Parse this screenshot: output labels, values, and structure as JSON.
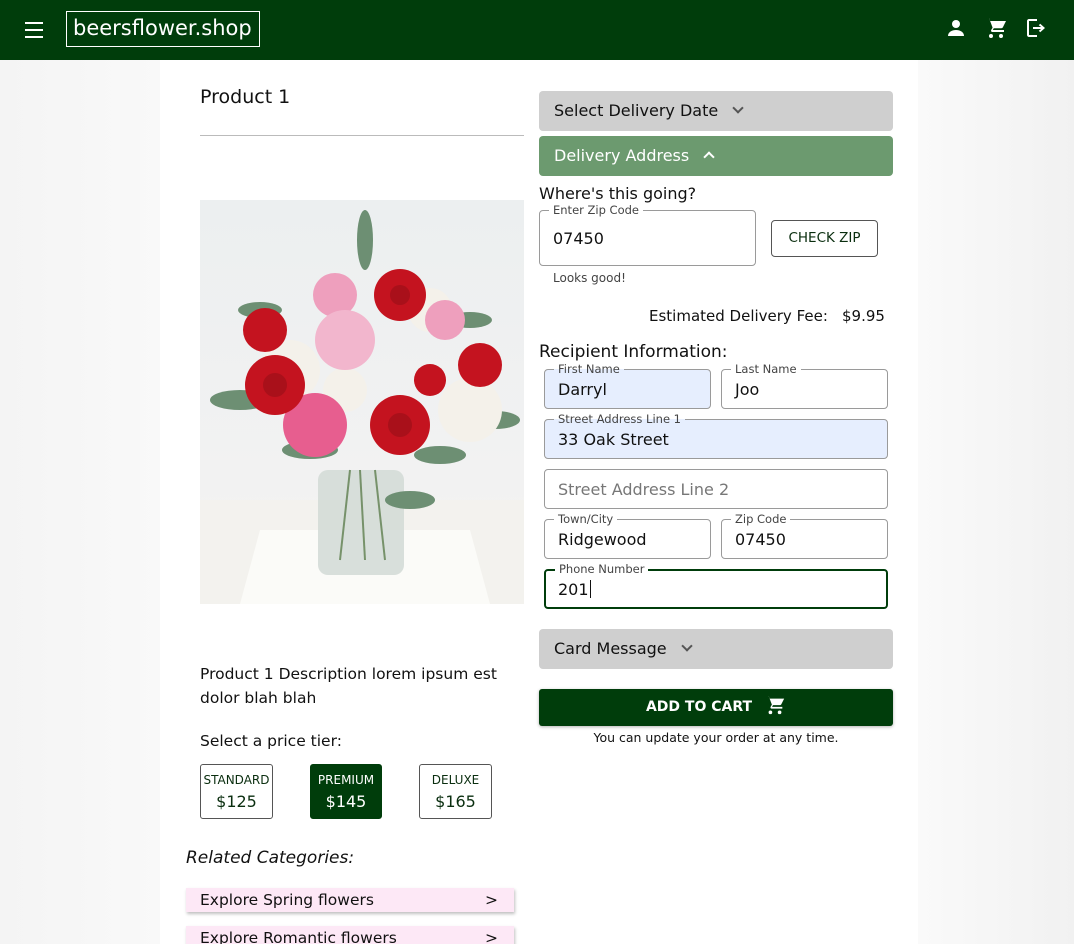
{
  "header": {
    "logo": "beersflower.shop",
    "icons": [
      "menu-icon",
      "account-icon",
      "cart-icon",
      "logout-icon"
    ]
  },
  "product": {
    "title": "Product 1",
    "description": "Product 1 Description lorem ipsum est dolor blah blah",
    "tier_label": "Select a price tier:",
    "tiers": [
      {
        "name": "STANDARD",
        "price": "$125",
        "selected": false
      },
      {
        "name": "PREMIUM",
        "price": "$145",
        "selected": true
      },
      {
        "name": "DELUXE",
        "price": "$165",
        "selected": false
      }
    ]
  },
  "related": {
    "title": "Related Categories:",
    "items": [
      {
        "label": "Explore Spring flowers",
        "arrow": ">"
      },
      {
        "label": "Explore Romantic flowers",
        "arrow": ">"
      }
    ]
  },
  "order": {
    "delivery_date": "Select Delivery Date",
    "delivery_address": "Delivery Address",
    "question": "Where's this going?",
    "zip_label": "Enter Zip Code",
    "zip_value": "07450",
    "check_zip": "CHECK ZIP",
    "zip_helper": "Looks good!",
    "fee_label": "Estimated Delivery Fee:",
    "fee_value": "$9.95",
    "recipient_title": "Recipient Information:",
    "card_message": "Card Message",
    "add_to_cart": "ADD TO CART",
    "update_note": "You can update your order at any time."
  },
  "recipient": {
    "first_name": {
      "label": "First Name",
      "value": "Darryl"
    },
    "last_name": {
      "label": "Last Name",
      "value": "Joo"
    },
    "street1": {
      "label": "Street Address Line 1",
      "value": "33 Oak Street"
    },
    "street2": {
      "placeholder": "Street Address Line 2"
    },
    "town": {
      "label": "Town/City",
      "value": "Ridgewood"
    },
    "zip": {
      "label": "Zip Code",
      "value": "07450"
    },
    "phone": {
      "label": "Phone Number",
      "value": "201"
    }
  },
  "colors": {
    "primary": "#003d0b",
    "accordion_open": "#6c9a6f",
    "accordion_closed": "#cfcfcf",
    "autofill": "#e6eefe",
    "category_bg": "#fde8f6"
  }
}
